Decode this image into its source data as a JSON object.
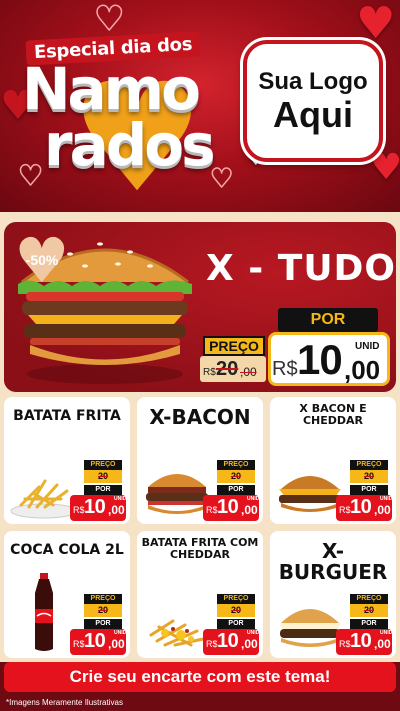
{
  "header": {
    "title_top": "Especial dia dos",
    "title_line1": "Namo",
    "title_line2": "rados",
    "logo_line1": "Sua Logo",
    "logo_line2": "Aqui"
  },
  "featured": {
    "name": "X - TUDO",
    "discount": "-50%",
    "preco_label": "PREÇO",
    "old_currency": "R$",
    "old_price": "20",
    "old_cents": ",00",
    "por_label": "POR",
    "currency": "R$",
    "price": "10",
    "cents": ",00",
    "unit": "UNID"
  },
  "price_labels": {
    "preco": "PREÇO",
    "por": "POR",
    "currency": "R$",
    "unit": "UNID",
    "cents": ",00"
  },
  "products": [
    {
      "name": "BATATA FRITA",
      "old_price": "20",
      "price": "10"
    },
    {
      "name": "X-BACON",
      "old_price": "20",
      "price": "10"
    },
    {
      "name": "X BACON E CHEDDAR",
      "old_price": "20",
      "price": "10"
    },
    {
      "name": "COCA COLA 2L",
      "old_price": "20",
      "price": "10"
    },
    {
      "name": "BATATA FRITA COM CHEDDAR",
      "old_price": "20",
      "price": "10"
    },
    {
      "name": "X-BURGUER",
      "old_price": "20",
      "price": "10"
    }
  ],
  "cta": "Crie seu encarte com este tema!",
  "footnote": "*Imagens Meramente Ilustrativas",
  "colors": {
    "red": "#e4121c",
    "dark_red": "#8a0f17",
    "yellow": "#f6b818",
    "cream": "#f6e2c6"
  }
}
